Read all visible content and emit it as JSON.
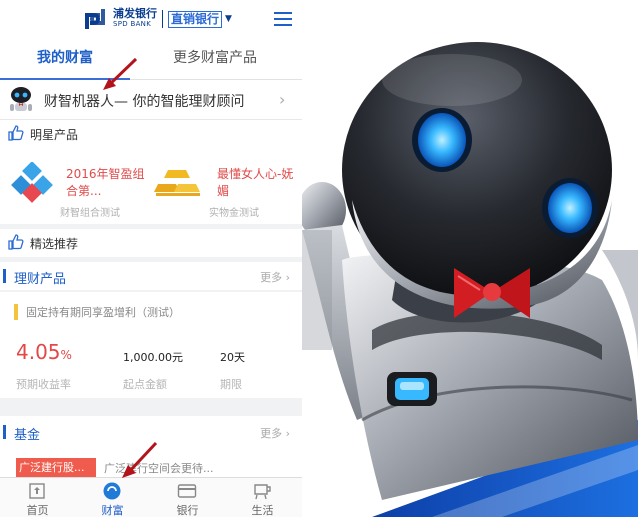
{
  "header": {
    "bank_name_cn": "浦发银行",
    "bank_name_en": "SPD BANK",
    "channel": "直销银行"
  },
  "tabs": [
    {
      "label": "我的财富",
      "active": true
    },
    {
      "label": "更多财富产品",
      "active": false
    }
  ],
  "robot_advisor": {
    "label": "财智机器人— 你的智能理财顾问"
  },
  "star_products": {
    "title": "明星产品",
    "items": [
      {
        "name": "2016年智盈组合第...",
        "subtitle": "财智组合测试",
        "icon": "diamond-cluster-icon"
      },
      {
        "name": "最懂女人心-妩媚",
        "subtitle": "实物金测试",
        "icon": "gold-bars-icon"
      }
    ]
  },
  "recommended": {
    "title": "精选推荐"
  },
  "wealth_products": {
    "title": "理财产品",
    "more": "更多",
    "product": {
      "name": "固定持有期同享盈增利（测试）",
      "rate_value": "4.05",
      "rate_unit": "%",
      "amount": "1,000.00元",
      "period": "20天",
      "rate_caption": "预期收益率",
      "amount_caption": "起点金额",
      "period_caption": "期限"
    }
  },
  "funds": {
    "title": "基金",
    "more": "更多",
    "tag": "广泛建行股...",
    "tag_text": "广泛建行空间会更待..."
  },
  "bottom_nav": [
    {
      "label": "首页",
      "icon": "home-icon",
      "active": false
    },
    {
      "label": "财富",
      "icon": "wealth-icon",
      "active": true
    },
    {
      "label": "银行",
      "icon": "card-icon",
      "active": false
    },
    {
      "label": "生活",
      "icon": "life-icon",
      "active": false
    }
  ],
  "colors": {
    "brand_blue": "#1f5fc9",
    "accent_red": "#e24848",
    "annotation_arrow": "#b3141b",
    "robot_eye": "#26a9ff",
    "bowtie": "#d21d23"
  }
}
